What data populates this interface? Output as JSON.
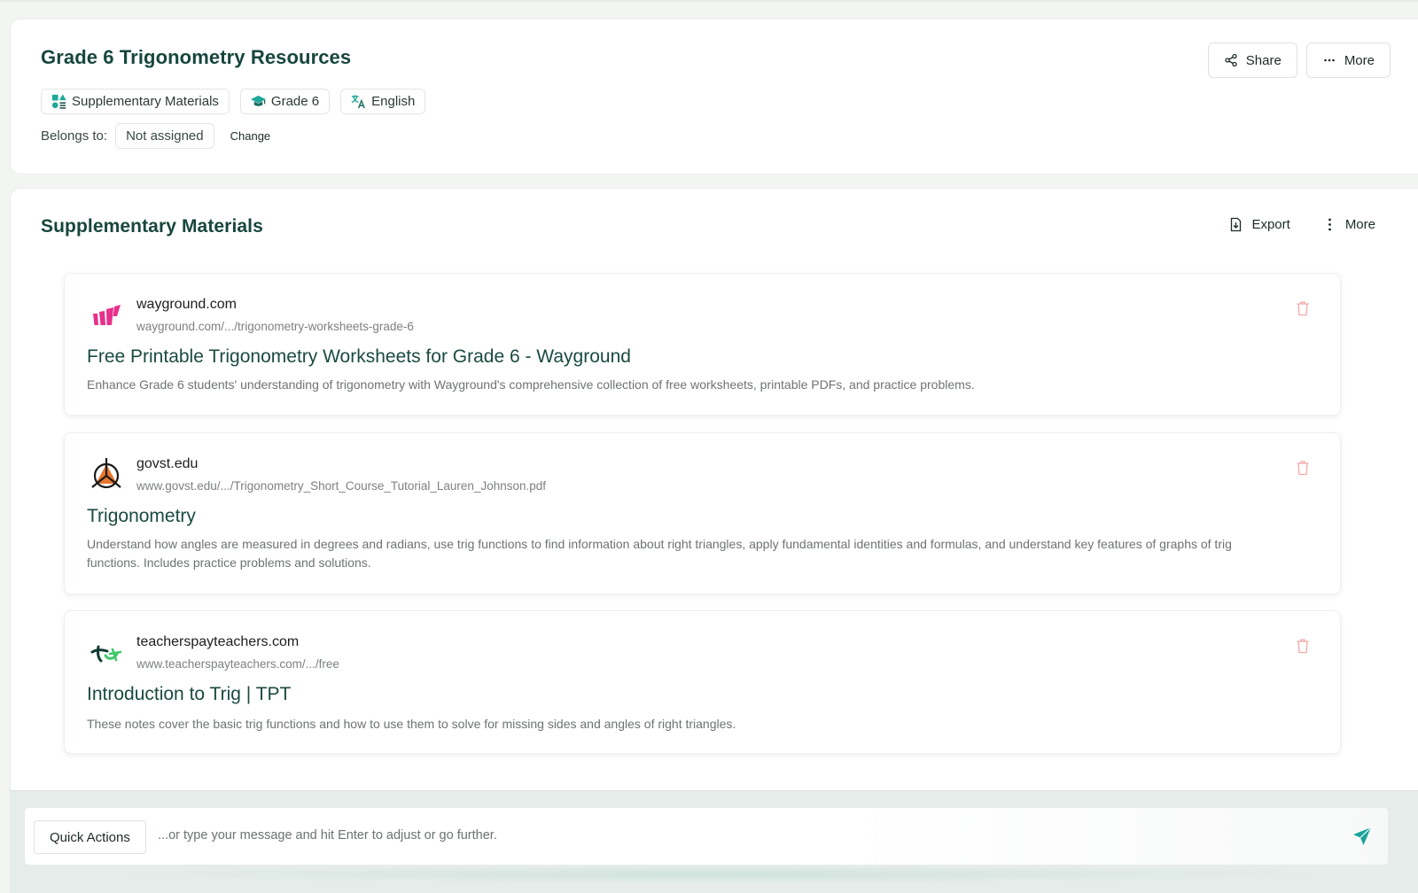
{
  "header": {
    "title": "Grade 6 Trigonometry Resources",
    "share_label": "Share",
    "more_label": "More",
    "tags": [
      {
        "label": "Supplementary Materials",
        "icon": "materials-icon"
      },
      {
        "label": "Grade 6",
        "icon": "graduation-cap-icon"
      },
      {
        "label": "English",
        "icon": "translate-icon"
      }
    ],
    "belongs_label": "Belongs to:",
    "belongs_value": "Not assigned",
    "change_label": "Change"
  },
  "materials": {
    "title": "Supplementary Materials",
    "export_label": "Export",
    "more_label": "More",
    "items": [
      {
        "domain": "wayground.com",
        "url": "wayground.com/.../trigonometry-worksheets-grade-6",
        "title": "Free Printable Trigonometry Worksheets for Grade 6 - Wayground",
        "description": "Enhance Grade 6 students' understanding of trigonometry with Wayground's comprehensive collection of free worksheets, printable PDFs, and practice problems.",
        "logo": "wayground-logo-icon"
      },
      {
        "domain": "govst.edu",
        "url": "www.govst.edu/.../Trigonometry_Short_Course_Tutorial_Lauren_Johnson.pdf",
        "title": "Trigonometry",
        "description": "Understand how angles are measured in degrees and radians, use trig functions to find information about right triangles, apply fundamental identities and formulas, and understand key features of graphs of trig functions. Includes practice problems and solutions.",
        "logo": "govst-logo-icon"
      },
      {
        "domain": "teacherspayteachers.com",
        "url": "www.teacherspayteachers.com/.../free",
        "title": "Introduction to Trig | TPT",
        "description": "These notes cover the basic trig functions and how to use them to solve for missing sides and angles of right triangles.",
        "logo": "tpt-logo-icon"
      }
    ]
  },
  "chat": {
    "quick_actions_label": "Quick Actions",
    "placeholder": "...or type your message and hit Enter to adjust or go further."
  },
  "colors": {
    "title_green": "#17463d",
    "accent_teal": "#1aa39a",
    "trash_red": "#f2a7a7",
    "wayground_pink": "#e8308c"
  }
}
